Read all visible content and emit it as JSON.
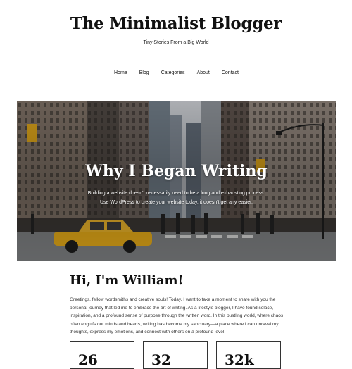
{
  "site": {
    "title": "The Minimalist Blogger",
    "tagline": "Tiny Stories From a Big World"
  },
  "nav": {
    "items": [
      "Home",
      "Blog",
      "Categories",
      "About",
      "Contact"
    ]
  },
  "hero": {
    "title": "Why I Began Writing",
    "text": "Building a website doesn't necessarily need to be a long and exhausting process. Use WordPress to create your website today, it doesn't get any easier."
  },
  "about": {
    "heading": "Hi, I'm William!",
    "body": "Greetings, fellow wordsmiths and creative souls! Today, I want to take a moment to share with you the personal journey that led me to embrace the art of writing. As a lifestyle blogger, I have found solace, inspiration, and a profound sense of purpose through the written word. In this bustling world, where chaos often engulfs our minds and hearts, writing has become my sanctuary—a place where I can unravel my thoughts, express my emotions, and connect with others on a profound level."
  },
  "stats": [
    "26",
    "32",
    "32k"
  ]
}
